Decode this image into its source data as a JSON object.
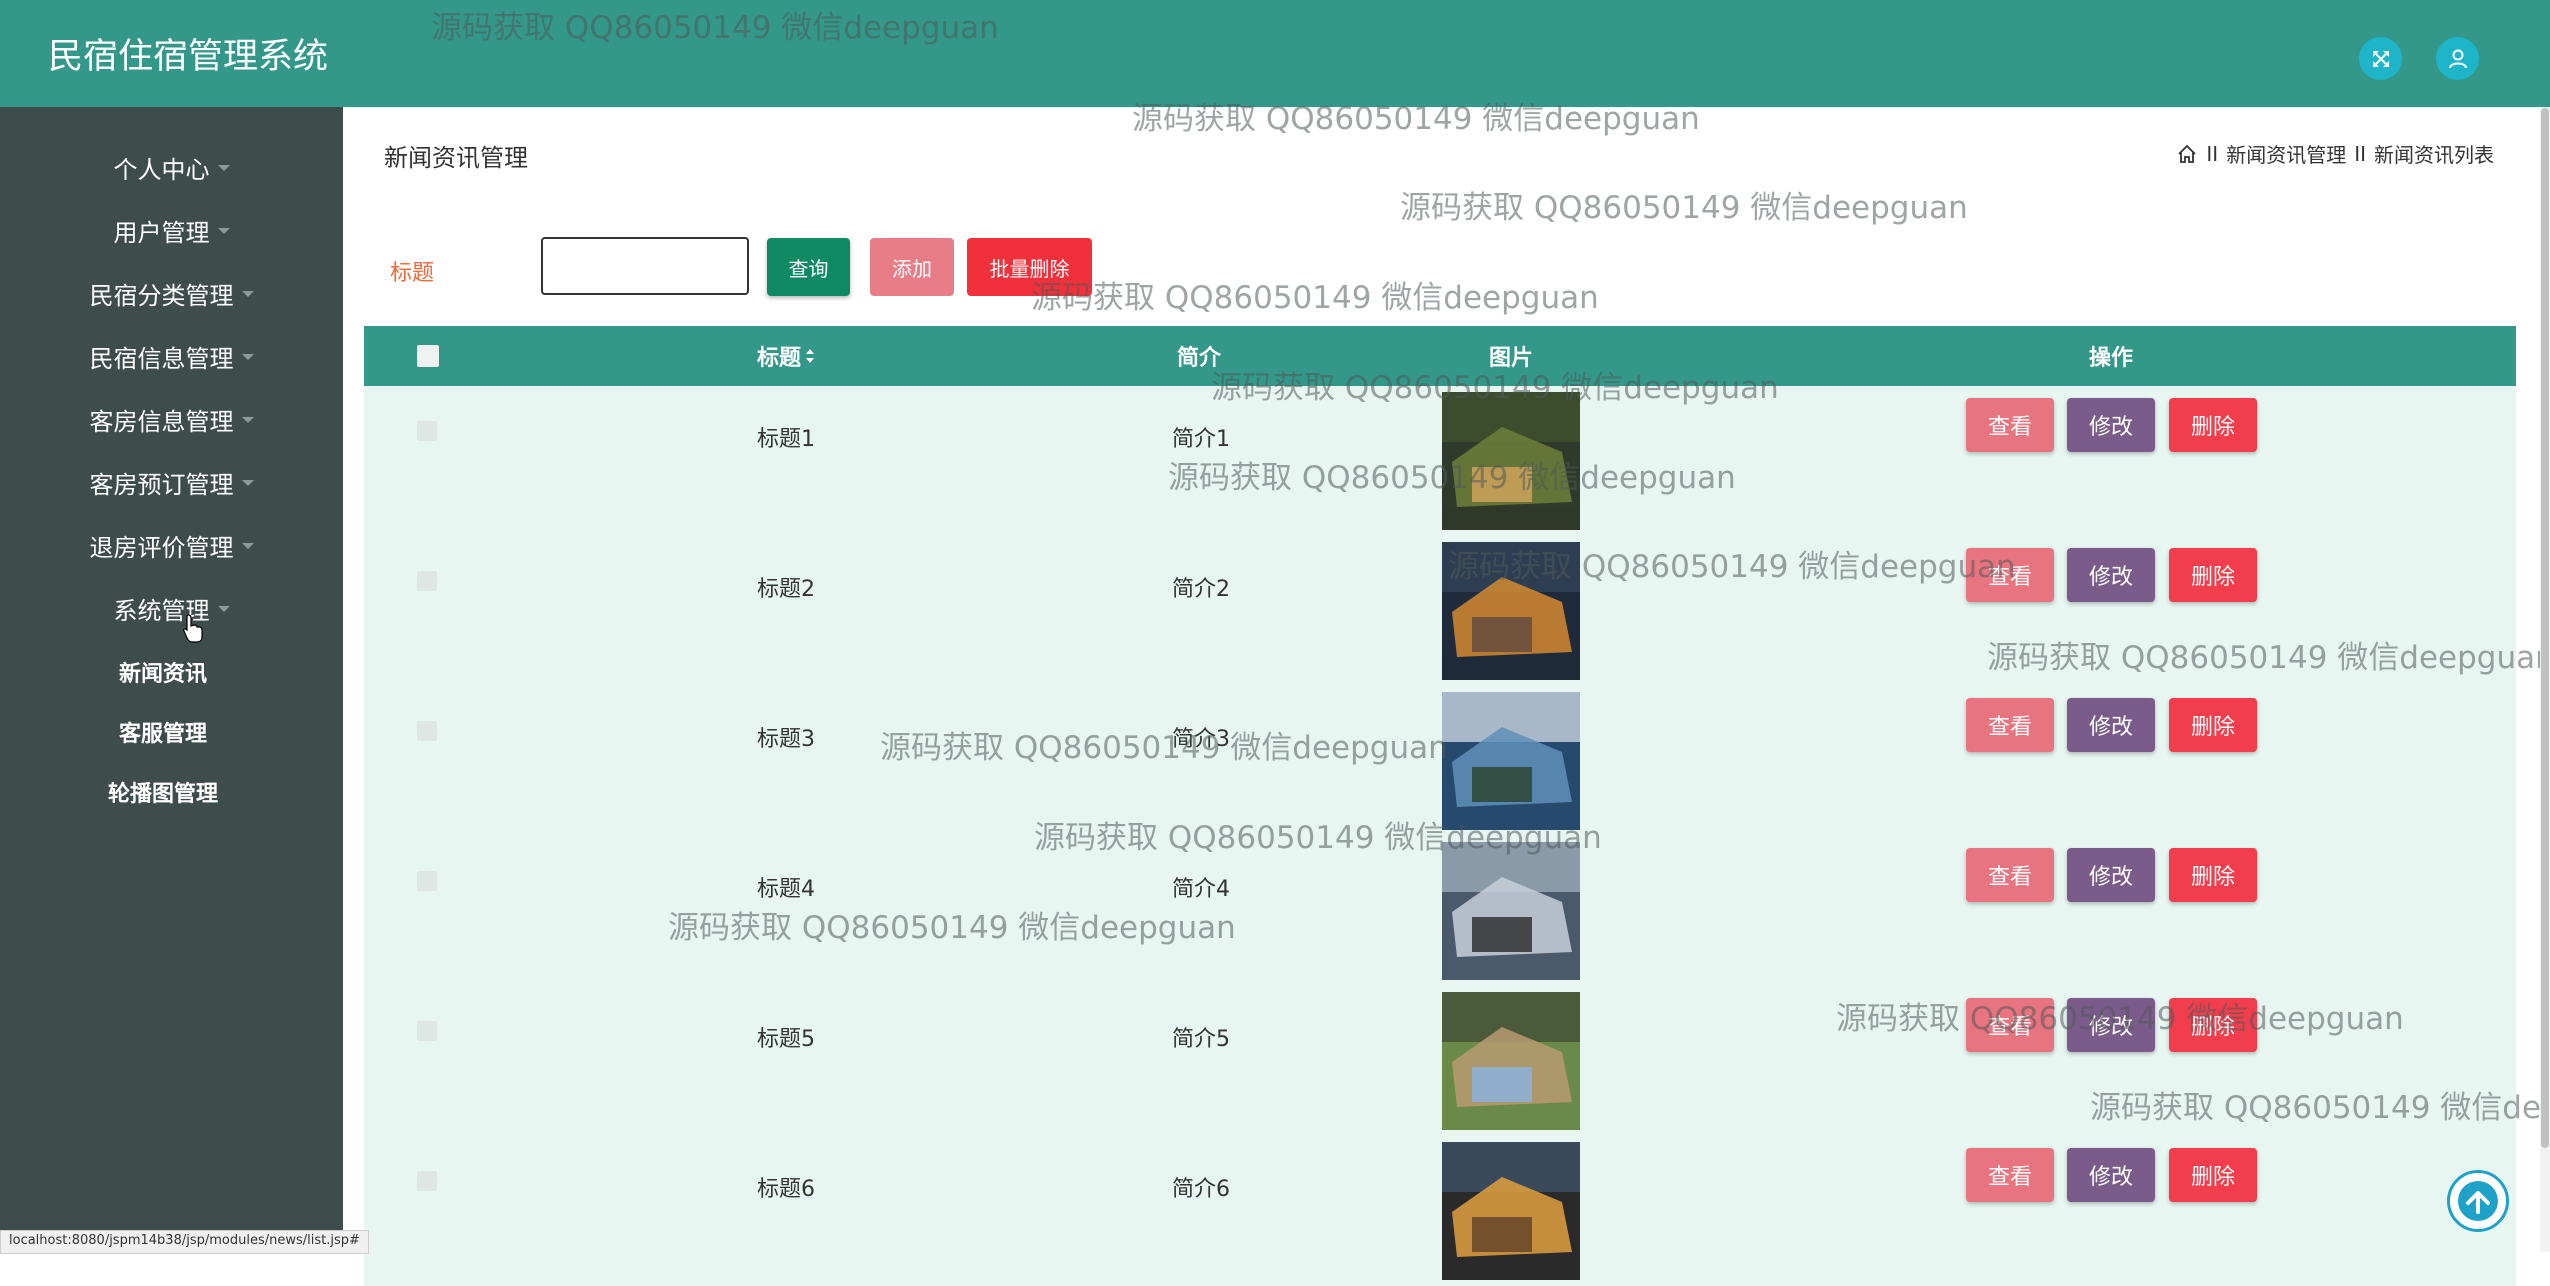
{
  "app": {
    "title": "民宿住宿管理系统"
  },
  "colors": {
    "header": "#33978a",
    "sidebar": "#3f4c4c",
    "table_row": "#e8f6f2",
    "view": "#e8747f",
    "edit": "#7a5b8a",
    "delete": "#f23e4c",
    "query": "#0e8a62",
    "add": "#e87d88",
    "batch_delete": "#f0303a"
  },
  "header": {
    "fullscreen_icon": "expand-arrows-icon",
    "user_icon": "user-icon"
  },
  "sidebar": {
    "items": [
      {
        "label": "个人中心"
      },
      {
        "label": "用户管理"
      },
      {
        "label": "民宿分类管理"
      },
      {
        "label": "民宿信息管理"
      },
      {
        "label": "客房信息管理"
      },
      {
        "label": "客房预订管理"
      },
      {
        "label": "退房评价管理"
      },
      {
        "label": "系统管理"
      }
    ],
    "submenu": [
      {
        "label": "新闻资讯"
      },
      {
        "label": "客服管理"
      },
      {
        "label": "轮播图管理"
      }
    ]
  },
  "page": {
    "title": "新闻资讯管理",
    "breadcrumb": {
      "sep": "II",
      "level1": "新闻资讯管理",
      "level2": "新闻资讯列表"
    }
  },
  "search": {
    "label": "标题",
    "value": "",
    "query": "查询",
    "add": "添加",
    "batch_delete": "批量删除"
  },
  "table": {
    "headers": {
      "title": "标题",
      "intro": "简介",
      "image": "图片",
      "actions": "操作"
    },
    "actions": {
      "view": "查看",
      "edit": "修改",
      "delete": "删除"
    },
    "rows": [
      {
        "title": "标题1",
        "intro": "简介1"
      },
      {
        "title": "标题2",
        "intro": "简介2"
      },
      {
        "title": "标题3",
        "intro": "简介3"
      },
      {
        "title": "标题4",
        "intro": "简介4"
      },
      {
        "title": "标题5",
        "intro": "简介5"
      },
      {
        "title": "标题6",
        "intro": "简介6"
      }
    ]
  },
  "watermark": "源码获取 QQ86050149 微信deepguan",
  "status_url": "localhost:8080/jspm14b38/jsp/modules/news/list.jsp#"
}
